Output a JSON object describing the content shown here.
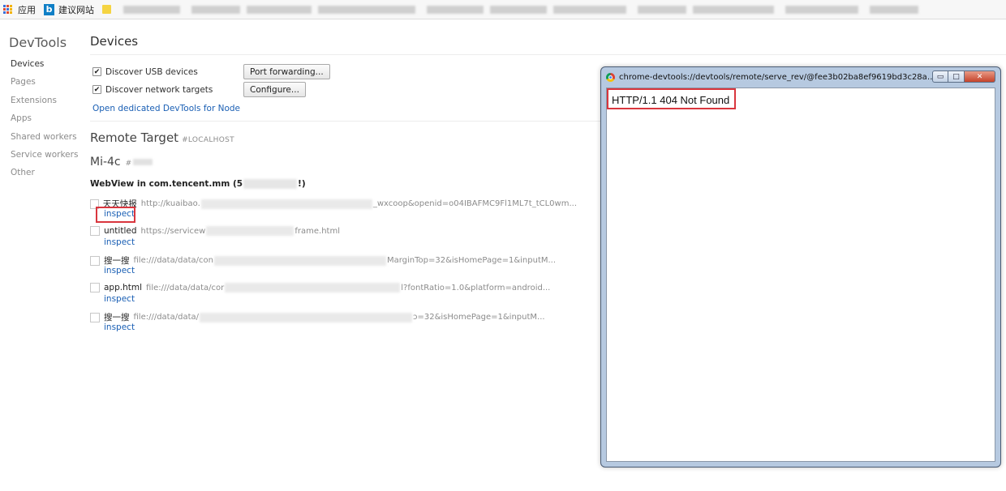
{
  "bookmarks": {
    "apps_label": "应用",
    "suggested_label": "建议网站"
  },
  "sidebar": {
    "title": "DevTools",
    "items": [
      {
        "label": "Devices",
        "active": true
      },
      {
        "label": "Pages"
      },
      {
        "label": "Extensions"
      },
      {
        "label": "Apps"
      },
      {
        "label": "Shared workers"
      },
      {
        "label": "Service workers"
      },
      {
        "label": "Other"
      }
    ]
  },
  "main": {
    "title": "Devices",
    "usb": {
      "label": "Discover USB devices",
      "checked": true,
      "button": "Port forwarding..."
    },
    "network": {
      "label": "Discover network targets",
      "checked": true,
      "button": "Configure..."
    },
    "node_link": "Open dedicated DevTools for Node",
    "remote_target": {
      "title": "Remote Target",
      "tag": "#LOCALHOST"
    },
    "device": {
      "name": "Mi-4c",
      "tag": "#"
    },
    "webview": {
      "title_prefix": "WebView in com.tencent.mm (5",
      "title_suffix": "!)"
    },
    "targets": [
      {
        "name": "天天快报",
        "url_start": "http://kuaibao.",
        "url_end": "_wxcoop&openid=o04IBAFMC9Fl1ML7t_tCL0wm...",
        "inspect": "inspect"
      },
      {
        "name": "untitled",
        "url_start": "https://servicew",
        "url_end": "frame.html",
        "inspect": "inspect"
      },
      {
        "name": "搜一搜",
        "url_start": "file:///data/data/con",
        "url_end": "MarginTop=32&isHomePage=1&inputM...",
        "inspect": "inspect"
      },
      {
        "name": "app.html",
        "url_start": "file:///data/data/cor",
        "url_end": "l?fontRatio=1.0&platform=android...",
        "inspect": "inspect"
      },
      {
        "name": "搜一搜",
        "url_start": "file:///data/data/",
        "url_end": "ɔ=32&isHomePage=1&inputM...",
        "inspect": "inspect"
      }
    ]
  },
  "popup": {
    "title": "chrome-devtools://devtools/remote/serve_rev/@fee3b02ba8ef9619bd3c28ad40ab2...",
    "body_text": "HTTP/1.1 404 Not Found"
  },
  "colors": {
    "link": "#1a5fb4",
    "highlight": "#d9363e"
  }
}
